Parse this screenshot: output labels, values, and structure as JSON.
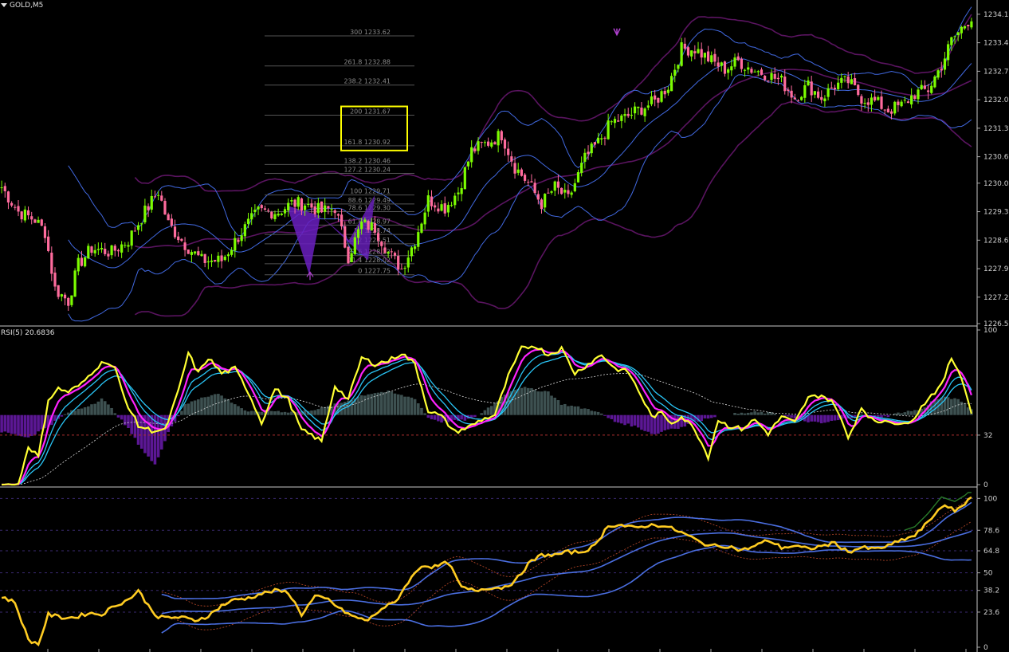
{
  "window": {
    "title": "GOLD,M5",
    "rsi_label": "RSI(5) 20.6836"
  },
  "colors": {
    "background": "#000000",
    "bull_candle": "#7cfc00",
    "bear_candle": "#ff6b9d",
    "bollinger_inner": "#4169e1",
    "bollinger_outer": "#5a1460",
    "rsi_line": "#ffff33",
    "rsi_signal": "#ff22ff",
    "rsi_bands": "#29c5f6",
    "histogram_pos": "#3d5050",
    "histogram_neg": "#5b1794",
    "stoch_line": "#ffcc22",
    "stoch_bands": "#4a6ee0",
    "fib_lines": "#555555",
    "highlight_box": "#ffff00",
    "axis_text": "#cfcfcf"
  },
  "chart_data": [
    {
      "type": "candlestick",
      "name": "GOLD,M5",
      "ylim": [
        1226.55,
        1234.5
      ],
      "yticks": [
        "1234.15",
        "1233.45",
        "1232.75",
        "1232.05",
        "1231.35",
        "1230.65",
        "1230.00",
        "1229.30",
        "1228.60",
        "1227.90",
        "1227.20",
        "1226.55"
      ],
      "ytick_values": [
        1234.15,
        1233.45,
        1232.75,
        1232.05,
        1231.35,
        1230.65,
        1230.0,
        1229.3,
        1228.6,
        1227.9,
        1227.2,
        1226.55
      ],
      "close_anchors": [
        [
          0,
          1229.9
        ],
        [
          5,
          1229.3
        ],
        [
          10,
          1229.1
        ],
        [
          13,
          1228.8
        ],
        [
          16,
          1227.4
        ],
        [
          20,
          1227.1
        ],
        [
          23,
          1228.0
        ],
        [
          27,
          1228.4
        ],
        [
          33,
          1228.3
        ],
        [
          38,
          1228.6
        ],
        [
          43,
          1229.3
        ],
        [
          47,
          1229.8
        ],
        [
          50,
          1229.0
        ],
        [
          55,
          1228.5
        ],
        [
          60,
          1228.1
        ],
        [
          66,
          1228.1
        ],
        [
          72,
          1228.8
        ],
        [
          77,
          1229.3
        ],
        [
          83,
          1229.3
        ],
        [
          87,
          1229.5
        ],
        [
          91,
          1229.5
        ],
        [
          96,
          1229.3
        ],
        [
          100,
          1229.4
        ],
        [
          104,
          1228.2
        ],
        [
          108,
          1229.0
        ],
        [
          112,
          1228.9
        ],
        [
          116,
          1228.3
        ],
        [
          120,
          1227.9
        ],
        [
          124,
          1228.6
        ],
        [
          128,
          1229.6
        ],
        [
          133,
          1229.4
        ],
        [
          137,
          1229.8
        ],
        [
          141,
          1230.8
        ],
        [
          146,
          1231.0
        ],
        [
          150,
          1231.2
        ],
        [
          154,
          1230.4
        ],
        [
          158,
          1230.0
        ],
        [
          162,
          1229.5
        ],
        [
          166,
          1229.9
        ],
        [
          170,
          1229.6
        ],
        [
          175,
          1230.6
        ],
        [
          179,
          1231.0
        ],
        [
          183,
          1231.5
        ],
        [
          187,
          1231.6
        ],
        [
          191,
          1231.8
        ],
        [
          196,
          1232.0
        ],
        [
          200,
          1232.4
        ],
        [
          204,
          1233.3
        ],
        [
          208,
          1233.3
        ],
        [
          213,
          1233.0
        ],
        [
          217,
          1232.8
        ],
        [
          221,
          1233.0
        ],
        [
          225,
          1232.8
        ],
        [
          229,
          1232.7
        ],
        [
          234,
          1232.5
        ],
        [
          238,
          1232.1
        ],
        [
          242,
          1232.4
        ],
        [
          246,
          1232.1
        ],
        [
          250,
          1232.4
        ],
        [
          254,
          1232.5
        ],
        [
          258,
          1232.1
        ],
        [
          262,
          1232.0
        ],
        [
          266,
          1231.8
        ],
        [
          270,
          1231.9
        ],
        [
          274,
          1232.2
        ],
        [
          278,
          1232.3
        ],
        [
          282,
          1232.9
        ],
        [
          285,
          1233.5
        ],
        [
          288,
          1233.8
        ],
        [
          291,
          1234.1
        ]
      ],
      "candle_count": 292,
      "fibonacci": {
        "levels": [
          {
            "ratio": "300",
            "price": "1233.62"
          },
          {
            "ratio": "261.8",
            "price": "1232.88"
          },
          {
            "ratio": "238.2",
            "price": "1232.41"
          },
          {
            "ratio": "200",
            "price": "1231.67"
          },
          {
            "ratio": "161.8",
            "price": "1230.92"
          },
          {
            "ratio": "138.2",
            "price": "1230.46"
          },
          {
            "ratio": "127.2",
            "price": "1230.24"
          },
          {
            "ratio": "100",
            "price": "1229.71"
          },
          {
            "ratio": "88.6",
            "price": "1229.49"
          },
          {
            "ratio": "78.6",
            "price": "1229.30"
          },
          {
            "ratio": "61.8",
            "price": "1228.97"
          },
          {
            "ratio": "50",
            "price": "1228.74"
          },
          {
            "ratio": "38.2",
            "price": "1228.51"
          },
          {
            "ratio": "23.6",
            "price": "1228.22"
          },
          {
            "ratio": "11.4",
            "price": "1228.02"
          },
          {
            "ratio": "0",
            "price": "1227.75"
          }
        ],
        "highlight_levels": [
          "200",
          "161.8"
        ]
      }
    },
    {
      "type": "line",
      "name": "RSI(5)",
      "value": 20.6836,
      "ylim": [
        0,
        100
      ],
      "yticks": [
        "100",
        "32",
        "0"
      ],
      "ytick_values": [
        100,
        32,
        0
      ],
      "level_line": 32,
      "rsi_anchors": [
        [
          0,
          0
        ],
        [
          5,
          0
        ],
        [
          8,
          25
        ],
        [
          11,
          18
        ],
        [
          14,
          55
        ],
        [
          17,
          62
        ],
        [
          20,
          60
        ],
        [
          24,
          65
        ],
        [
          28,
          75
        ],
        [
          31,
          80
        ],
        [
          34,
          75
        ],
        [
          37,
          55
        ],
        [
          41,
          38
        ],
        [
          45,
          35
        ],
        [
          49,
          35
        ],
        [
          53,
          60
        ],
        [
          56,
          85
        ],
        [
          59,
          72
        ],
        [
          62,
          82
        ],
        [
          66,
          72
        ],
        [
          70,
          75
        ],
        [
          74,
          60
        ],
        [
          78,
          40
        ],
        [
          82,
          62
        ],
        [
          86,
          55
        ],
        [
          90,
          35
        ],
        [
          93,
          32
        ],
        [
          96,
          28
        ],
        [
          100,
          64
        ],
        [
          104,
          55
        ],
        [
          108,
          82
        ],
        [
          112,
          78
        ],
        [
          116,
          80
        ],
        [
          120,
          85
        ],
        [
          124,
          78
        ],
        [
          128,
          48
        ],
        [
          132,
          44
        ],
        [
          136,
          34
        ],
        [
          140,
          37
        ],
        [
          144,
          42
        ],
        [
          148,
          45
        ],
        [
          152,
          70
        ],
        [
          156,
          88
        ],
        [
          160,
          90
        ],
        [
          164,
          84
        ],
        [
          168,
          88
        ],
        [
          172,
          72
        ],
        [
          176,
          78
        ],
        [
          180,
          84
        ],
        [
          184,
          75
        ],
        [
          188,
          73
        ],
        [
          192,
          57
        ],
        [
          195,
          44
        ],
        [
          198,
          46
        ],
        [
          201,
          40
        ],
        [
          204,
          44
        ],
        [
          208,
          36
        ],
        [
          212,
          18
        ],
        [
          215,
          42
        ],
        [
          218,
          38
        ],
        [
          222,
          36
        ],
        [
          226,
          42
        ],
        [
          230,
          33
        ],
        [
          234,
          44
        ],
        [
          238,
          40
        ],
        [
          242,
          56
        ],
        [
          246,
          58
        ],
        [
          250,
          52
        ],
        [
          254,
          30
        ],
        [
          258,
          50
        ],
        [
          262,
          40
        ],
        [
          266,
          42
        ],
        [
          270,
          38
        ],
        [
          274,
          44
        ],
        [
          278,
          56
        ],
        [
          282,
          64
        ],
        [
          285,
          82
        ],
        [
          288,
          70
        ],
        [
          291,
          46
        ]
      ],
      "histogram": [
        [
          0,
          -0.3
        ],
        [
          8,
          -0.4
        ],
        [
          14,
          -0.2
        ],
        [
          20,
          0.05
        ],
        [
          24,
          0.12
        ],
        [
          28,
          0.22
        ],
        [
          30,
          0.3
        ],
        [
          34,
          0.05
        ],
        [
          38,
          -0.25
        ],
        [
          42,
          -0.6
        ],
        [
          46,
          -0.9
        ],
        [
          50,
          -0.3
        ],
        [
          55,
          0.18
        ],
        [
          60,
          0.32
        ],
        [
          65,
          0.38
        ],
        [
          70,
          0.2
        ],
        [
          74,
          0.05
        ],
        [
          80,
          0.08
        ],
        [
          88,
          0.05
        ],
        [
          96,
          0.12
        ],
        [
          102,
          0.22
        ],
        [
          108,
          0.35
        ],
        [
          112,
          0.4
        ],
        [
          116,
          0.42
        ],
        [
          120,
          0.35
        ],
        [
          124,
          0.3
        ],
        [
          128,
          -0.05
        ],
        [
          132,
          -0.12
        ],
        [
          138,
          -0.1
        ],
        [
          142,
          -0.05
        ],
        [
          148,
          0.22
        ],
        [
          152,
          0.42
        ],
        [
          156,
          0.5
        ],
        [
          160,
          0.45
        ],
        [
          164,
          0.42
        ],
        [
          168,
          0.2
        ],
        [
          172,
          0.15
        ],
        [
          178,
          0.08
        ],
        [
          184,
          -0.12
        ],
        [
          190,
          -0.2
        ],
        [
          196,
          -0.35
        ],
        [
          200,
          -0.25
        ],
        [
          204,
          -0.22
        ],
        [
          208,
          -0.12
        ],
        [
          214,
          -0.02
        ],
        [
          220,
          0.02
        ],
        [
          226,
          0.05
        ],
        [
          232,
          0.03
        ],
        [
          240,
          -0.1
        ],
        [
          246,
          -0.15
        ],
        [
          252,
          -0.08
        ],
        [
          258,
          0.0
        ],
        [
          264,
          -0.05
        ],
        [
          270,
          0.05
        ],
        [
          276,
          0.1
        ],
        [
          280,
          0.28
        ],
        [
          284,
          0.32
        ],
        [
          288,
          0.25
        ],
        [
          291,
          0.1
        ]
      ]
    },
    {
      "type": "line",
      "name": "stochastic",
      "ylim": [
        0,
        105
      ],
      "yticks": [
        "100",
        "78.6",
        "64.8",
        "50",
        "38.2",
        "23.6",
        "0"
      ],
      "ytick_values": [
        100,
        78.6,
        64.8,
        50,
        38.2,
        23.6,
        0
      ],
      "stoch_anchors": [
        [
          0,
          34
        ],
        [
          4,
          30
        ],
        [
          8,
          5
        ],
        [
          11,
          2
        ],
        [
          14,
          22
        ],
        [
          18,
          20
        ],
        [
          22,
          20
        ],
        [
          26,
          23
        ],
        [
          30,
          22
        ],
        [
          34,
          28
        ],
        [
          38,
          32
        ],
        [
          41,
          38
        ],
        [
          44,
          28
        ],
        [
          47,
          20
        ],
        [
          50,
          20
        ],
        [
          54,
          20
        ],
        [
          58,
          18
        ],
        [
          62,
          21
        ],
        [
          66,
          28
        ],
        [
          70,
          32
        ],
        [
          74,
          33
        ],
        [
          78,
          36
        ],
        [
          82,
          38
        ],
        [
          86,
          37
        ],
        [
          90,
          22
        ],
        [
          94,
          34
        ],
        [
          98,
          32
        ],
        [
          102,
          25
        ],
        [
          106,
          20
        ],
        [
          110,
          18
        ],
        [
          114,
          26
        ],
        [
          118,
          30
        ],
        [
          122,
          44
        ],
        [
          126,
          55
        ],
        [
          130,
          54
        ],
        [
          134,
          57
        ],
        [
          138,
          40
        ],
        [
          142,
          38
        ],
        [
          146,
          40
        ],
        [
          150,
          40
        ],
        [
          154,
          44
        ],
        [
          158,
          56
        ],
        [
          162,
          62
        ],
        [
          166,
          62
        ],
        [
          170,
          64
        ],
        [
          174,
          64
        ],
        [
          178,
          68
        ],
        [
          182,
          82
        ],
        [
          186,
          82
        ],
        [
          190,
          80
        ],
        [
          194,
          82
        ],
        [
          198,
          82
        ],
        [
          202,
          79
        ],
        [
          206,
          75
        ],
        [
          210,
          70
        ],
        [
          214,
          68
        ],
        [
          218,
          68
        ],
        [
          222,
          65
        ],
        [
          226,
          68
        ],
        [
          230,
          72
        ],
        [
          234,
          67
        ],
        [
          238,
          68
        ],
        [
          242,
          66
        ],
        [
          246,
          68
        ],
        [
          250,
          70
        ],
        [
          254,
          64
        ],
        [
          258,
          67
        ],
        [
          262,
          66
        ],
        [
          266,
          68
        ],
        [
          270,
          72
        ],
        [
          274,
          75
        ],
        [
          278,
          84
        ],
        [
          282,
          95
        ],
        [
          286,
          92
        ],
        [
          289,
          96
        ],
        [
          291,
          102
        ]
      ]
    }
  ]
}
